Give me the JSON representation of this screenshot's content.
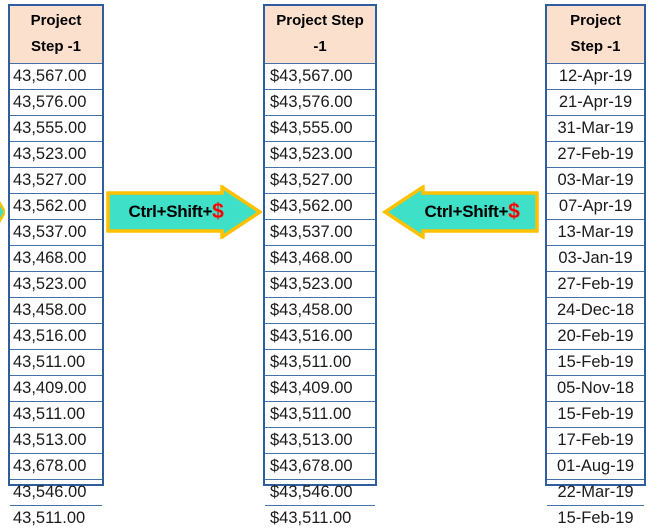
{
  "tables": [
    {
      "id": "raw",
      "name": "project-step-raw-numbers",
      "header_line1": "Project",
      "header_line2": "Step -1",
      "values": [
        "43,567.00",
        "43,576.00",
        "43,555.00",
        "43,523.00",
        "43,527.00",
        "43,562.00",
        "43,537.00",
        "43,468.00",
        "43,523.00",
        "43,458.00",
        "43,516.00",
        "43,511.00",
        "43,409.00",
        "43,511.00",
        "43,513.00",
        "43,678.00",
        "43,546.00",
        "43,511.00"
      ]
    },
    {
      "id": "currency",
      "name": "project-step-currency",
      "header_line1": "Project Step",
      "header_line2": "-1",
      "values": [
        "$43,567.00",
        "$43,576.00",
        "$43,555.00",
        "$43,523.00",
        "$43,527.00",
        "$43,562.00",
        "$43,537.00",
        "$43,468.00",
        "$43,523.00",
        "$43,458.00",
        "$43,516.00",
        "$43,511.00",
        "$43,409.00",
        "$43,511.00",
        "$43,513.00",
        "$43,678.00",
        "$43,546.00",
        "$43,511.00"
      ]
    },
    {
      "id": "dates",
      "name": "project-step-dates",
      "header_line1": "Project",
      "header_line2": "Step -1",
      "values": [
        "12-Apr-19",
        "21-Apr-19",
        "31-Mar-19",
        "27-Feb-19",
        "03-Mar-19",
        "07-Apr-19",
        "13-Mar-19",
        "03-Jan-19",
        "27-Feb-19",
        "24-Dec-18",
        "20-Feb-19",
        "15-Feb-19",
        "05-Nov-18",
        "15-Feb-19",
        "17-Feb-19",
        "01-Aug-19",
        "22-Mar-19",
        "15-Feb-19"
      ]
    }
  ],
  "arrows": [
    {
      "id": "right",
      "name": "shortcut-arrow-pointing-right",
      "direction": "right",
      "label_text": "Ctrl+Shift+",
      "label_symbol": "$"
    },
    {
      "id": "left",
      "name": "shortcut-arrow-pointing-left",
      "direction": "left",
      "label_text": "Ctrl+Shift+",
      "label_symbol": "$"
    }
  ],
  "colors": {
    "table_border": "#2E5E9E",
    "grid_line": "#4472A8",
    "header_fill": "#FBE0CE",
    "arrow_fill": "#3EE0C8",
    "arrow_outline": "#FFC000",
    "dollar_text": "#FF0000",
    "body_text": "#1B1B1B",
    "background": "#FFFFFF"
  }
}
